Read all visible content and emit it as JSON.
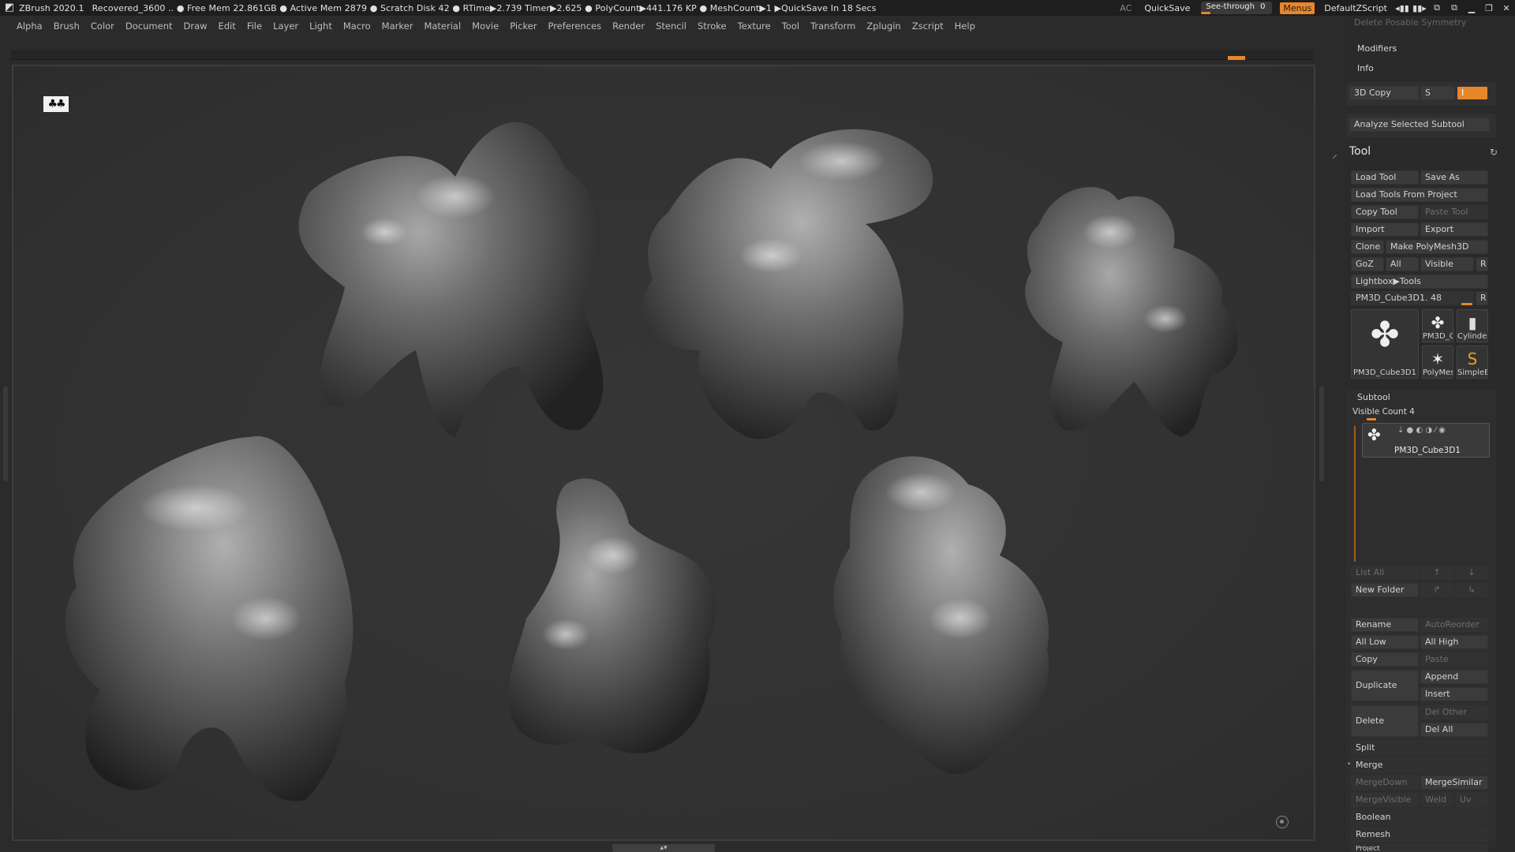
{
  "titlebar": {
    "app": "ZBrush 2020.1",
    "status": "Recovered_3600   .. ● Free Mem 22.861GB ● Active Mem 2879 ● Scratch Disk 42 ●  RTime▶2.739 Timer▶2.625 ● PolyCount▶441.176 KP  ● MeshCount▶1  ▶QuickSave In 18 Secs",
    "ac": "AC",
    "quicksave": "QuickSave",
    "see_through_label": "See-through",
    "see_through_value": "0",
    "menus": "Menus",
    "script": "DefaultZScript"
  },
  "menubar": [
    "Alpha",
    "Brush",
    "Color",
    "Document",
    "Draw",
    "Edit",
    "File",
    "Layer",
    "Light",
    "Macro",
    "Marker",
    "Material",
    "Movie",
    "Picker",
    "Preferences",
    "Render",
    "Stencil",
    "Stroke",
    "Texture",
    "Tool",
    "Transform",
    "Zplugin",
    "Zscript",
    "Help"
  ],
  "panel": {
    "top_faded": "Delete Posable Symmetry",
    "modifiers": "Modifiers",
    "info": "Info",
    "copy3d": "3D Copy",
    "copy3d_s": "S",
    "copy3d_i": "I",
    "analyze": "Analyze Selected Subtool",
    "tool_title": "Tool",
    "load_tool": "Load Tool",
    "save_as": "Save As",
    "load_from_project": "Load Tools From Project",
    "copy_tool": "Copy Tool",
    "paste_tool": "Paste Tool",
    "import": "Import",
    "export": "Export",
    "clone": "Clone",
    "make_polymesh": "Make PolyMesh3D",
    "goz": "GoZ",
    "all": "All",
    "visible": "Visible",
    "r": "R",
    "lightbox_tools": "Lightbox▶Tools",
    "current_tool": "PM3D_Cube3D1. 48",
    "current_tool_r": "R",
    "thumbs": {
      "main": "PM3D_Cube3D1",
      "t1": "PM3D_C",
      "t2": "Cylinder",
      "t3": "PolyMes",
      "t4": "SimpleB"
    },
    "subtool": "Subtool",
    "visible_count": "Visible Count 4",
    "subtool_name": "PM3D_Cube3D1",
    "list_all": "List All",
    "new_folder": "New Folder",
    "rename": "Rename",
    "autoreorder": "AutoReorder",
    "all_low": "All Low",
    "all_high": "All High",
    "copy": "Copy",
    "paste": "Paste",
    "duplicate": "Duplicate",
    "append": "Append",
    "insert": "Insert",
    "delete": "Delete",
    "del_other": "Del Other",
    "del_all": "Del All",
    "split": "Split",
    "merge": "Merge",
    "merge_down": "MergeDown",
    "merge_similar": "MergeSimilar",
    "merge_visible": "MergeVisible",
    "weld": "Weld",
    "uv": "Uv",
    "boolean": "Boolean",
    "remesh": "Remesh",
    "project": "Project"
  },
  "colors": {
    "accent": "#e8862a",
    "background": "#2b2b2b",
    "viewport": "#333333"
  }
}
